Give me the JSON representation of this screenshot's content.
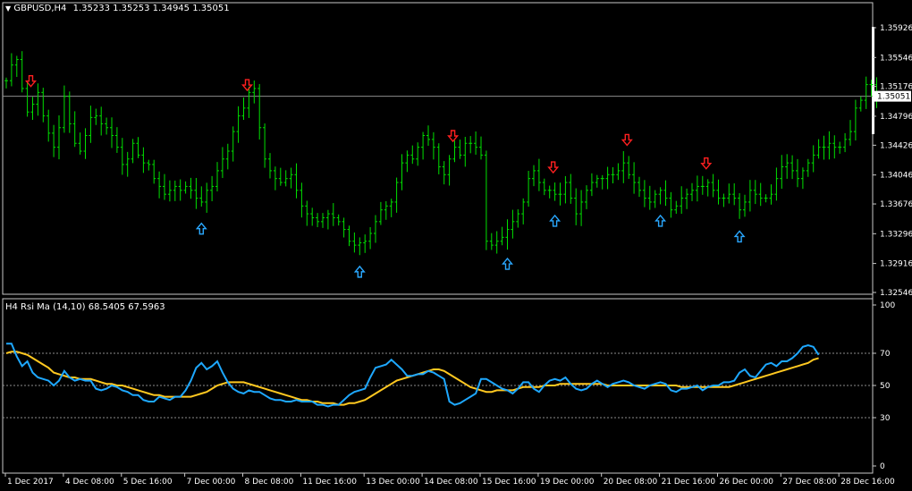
{
  "window": {
    "symbol_label": "GBPUSD,H4",
    "ohlc_label": "1.35233 1.35253 1.34945 1.35051"
  },
  "price_panel": {
    "current_price_label": "1.35051",
    "current_price": 1.35051,
    "y_ticks": [
      {
        "value": 1.35926,
        "label": "1.35926"
      },
      {
        "value": 1.35546,
        "label": "1.35546"
      },
      {
        "value": 1.35176,
        "label": "1.35176"
      },
      {
        "value": 1.34796,
        "label": "1.34796"
      },
      {
        "value": 1.34426,
        "label": "1.34426"
      },
      {
        "value": 1.34046,
        "label": "1.34046"
      },
      {
        "value": 1.33676,
        "label": "1.33676"
      },
      {
        "value": 1.33296,
        "label": "1.33296"
      },
      {
        "value": 1.32916,
        "label": "1.32916"
      },
      {
        "value": 1.32546,
        "label": "1.32546"
      }
    ],
    "bar_color": "#00e000",
    "sell_arrow_color": "#ff2020",
    "buy_arrow_color": "#2aa8ff"
  },
  "indicator_panel": {
    "label": "H4  Rsi Ma (14,10) 68.5405 67.5963",
    "levels": [
      {
        "value": 100,
        "label": "100"
      },
      {
        "value": 70,
        "label": "70"
      },
      {
        "value": 50,
        "label": "50"
      },
      {
        "value": 30,
        "label": "30"
      },
      {
        "value": 0,
        "label": "0"
      }
    ],
    "rsi_color": "#1ea8ff",
    "ma_color": "#ffc820"
  },
  "x_axis": {
    "labels": [
      {
        "bar": 0,
        "label": "1 Dec 2017"
      },
      {
        "bar": 11,
        "label": "4 Dec 08:00"
      },
      {
        "bar": 22,
        "label": "5 Dec 16:00"
      },
      {
        "bar": 34,
        "label": "7 Dec 00:00"
      },
      {
        "bar": 45,
        "label": "8 Dec 08:00"
      },
      {
        "bar": 56,
        "label": "11 Dec 16:00"
      },
      {
        "bar": 68,
        "label": "13 Dec 00:00"
      },
      {
        "bar": 79,
        "label": "14 Dec 08:00"
      },
      {
        "bar": 90,
        "label": "15 Dec 16:00"
      },
      {
        "bar": 101,
        "label": "19 Dec 00:00"
      },
      {
        "bar": 113,
        "label": "20 Dec 08:00"
      },
      {
        "bar": 124,
        "label": "21 Dec 16:00"
      },
      {
        "bar": 135,
        "label": "26 Dec 00:00"
      },
      {
        "bar": 147,
        "label": "27 Dec 08:00"
      },
      {
        "bar": 158,
        "label": "28 Dec 16:00"
      }
    ]
  },
  "chart_data": {
    "type": "ohlc",
    "prices": [
      1.3525,
      1.3545,
      1.3552,
      1.3515,
      1.3485,
      1.3495,
      1.351,
      1.348,
      1.3458,
      1.344,
      1.3465,
      1.3505,
      1.347,
      1.3445,
      1.3435,
      1.3455,
      1.3478,
      1.348,
      1.347,
      1.3465,
      1.3455,
      1.344,
      1.3418,
      1.3425,
      1.3445,
      1.343,
      1.342,
      1.3418,
      1.34,
      1.339,
      1.338,
      1.3385,
      1.339,
      1.3385,
      1.339,
      1.3385,
      1.3375,
      1.337,
      1.3385,
      1.339,
      1.341,
      1.3425,
      1.3435,
      1.346,
      1.348,
      1.349,
      1.351,
      1.3515,
      1.3465,
      1.3425,
      1.341,
      1.34,
      1.3395,
      1.34,
      1.3405,
      1.3385,
      1.3365,
      1.3355,
      1.335,
      1.3345,
      1.335,
      1.3355,
      1.335,
      1.3345,
      1.3335,
      1.332,
      1.3315,
      1.3318,
      1.332,
      1.333,
      1.3345,
      1.336,
      1.3365,
      1.337,
      1.3395,
      1.342,
      1.343,
      1.3425,
      1.344,
      1.3455,
      1.345,
      1.344,
      1.3415,
      1.3405,
      1.3425,
      1.344,
      1.343,
      1.3445,
      1.3445,
      1.344,
      1.343,
      1.332,
      1.3315,
      1.332,
      1.3325,
      1.3335,
      1.3345,
      1.3355,
      1.337,
      1.34,
      1.341,
      1.3395,
      1.3385,
      1.3385,
      1.338,
      1.338,
      1.3395,
      1.3375,
      1.3355,
      1.337,
      1.3385,
      1.3395,
      1.34,
      1.34,
      1.3405,
      1.3405,
      1.341,
      1.342,
      1.3405,
      1.3395,
      1.3385,
      1.3375,
      1.337,
      1.338,
      1.3385,
      1.3375,
      1.336,
      1.3365,
      1.3375,
      1.338,
      1.3385,
      1.339,
      1.339,
      1.3395,
      1.3385,
      1.3375,
      1.3375,
      1.338,
      1.3375,
      1.336,
      1.337,
      1.3385,
      1.338,
      1.3375,
      1.3375,
      1.338,
      1.34,
      1.3415,
      1.342,
      1.341,
      1.34,
      1.341,
      1.342,
      1.343,
      1.344,
      1.344,
      1.3445,
      1.344,
      1.344,
      1.345,
      1.346,
      1.349,
      1.35,
      1.352,
      1.352,
      1.3505
    ],
    "rsi": [
      76,
      76,
      68,
      62,
      65,
      58,
      55,
      54,
      53,
      50,
      53,
      59,
      55,
      53,
      54,
      53,
      53,
      48,
      47,
      48,
      50,
      49,
      47,
      46,
      44,
      44,
      41,
      40,
      40,
      43,
      42,
      41,
      43,
      43,
      47,
      53,
      61,
      64,
      60,
      62,
      65,
      58,
      52,
      48,
      46,
      45,
      47,
      46,
      46,
      44,
      42,
      41,
      41,
      40,
      40,
      41,
      40,
      40,
      40,
      38,
      38,
      37,
      38,
      38,
      41,
      44,
      46,
      47,
      48,
      55,
      61,
      62,
      63,
      66,
      63,
      60,
      56,
      56,
      57,
      57,
      59,
      58,
      56,
      54,
      40,
      38,
      39,
      41,
      43,
      45,
      54,
      54,
      52,
      50,
      48,
      47,
      45,
      48,
      52,
      52,
      48,
      46,
      50,
      53,
      54,
      53,
      55,
      51,
      48,
      47,
      48,
      51,
      53,
      51,
      49,
      51,
      52,
      53,
      52,
      50,
      49,
      48,
      50,
      51,
      52,
      51,
      47,
      46,
      48,
      48,
      49,
      50,
      47,
      49,
      50,
      50,
      52,
      52,
      53,
      58,
      60,
      56,
      55,
      59,
      63,
      64,
      62,
      65,
      65,
      67,
      70,
      74,
      75,
      74,
      69
    ],
    "rsi_ma": [
      70,
      71,
      71,
      70,
      69,
      67,
      65,
      63,
      61,
      58,
      57,
      56,
      55,
      55,
      54,
      54,
      54,
      53,
      52,
      51,
      51,
      50,
      50,
      49,
      48,
      47,
      46,
      45,
      44,
      44,
      43,
      43,
      43,
      43,
      43,
      43,
      44,
      45,
      46,
      48,
      50,
      51,
      52,
      52,
      52,
      52,
      51,
      50,
      49,
      48,
      47,
      46,
      45,
      44,
      43,
      42,
      41,
      41,
      40,
      40,
      39,
      39,
      39,
      38,
      38,
      39,
      39,
      40,
      41,
      43,
      45,
      47,
      49,
      51,
      53,
      54,
      55,
      56,
      57,
      58,
      59,
      60,
      60,
      59,
      57,
      55,
      53,
      51,
      49,
      48,
      47,
      46,
      46,
      47,
      47,
      47,
      47,
      48,
      49,
      49,
      49,
      49,
      50,
      50,
      50,
      51,
      51,
      51,
      51,
      51,
      51,
      51,
      51,
      51,
      50,
      50,
      50,
      50,
      50,
      50,
      50,
      50,
      50,
      50,
      50,
      50,
      50,
      50,
      49,
      49,
      49,
      49,
      49,
      49,
      49,
      49,
      49,
      49,
      50,
      51,
      52,
      53,
      54,
      55,
      56,
      57,
      58,
      59,
      60,
      61,
      62,
      63,
      64,
      66,
      67
    ],
    "sell_signal_bars": [
      5,
      45,
      84,
      103,
      117,
      132
    ],
    "buy_signal_bars": [
      37,
      67,
      95,
      104,
      124,
      139
    ]
  }
}
